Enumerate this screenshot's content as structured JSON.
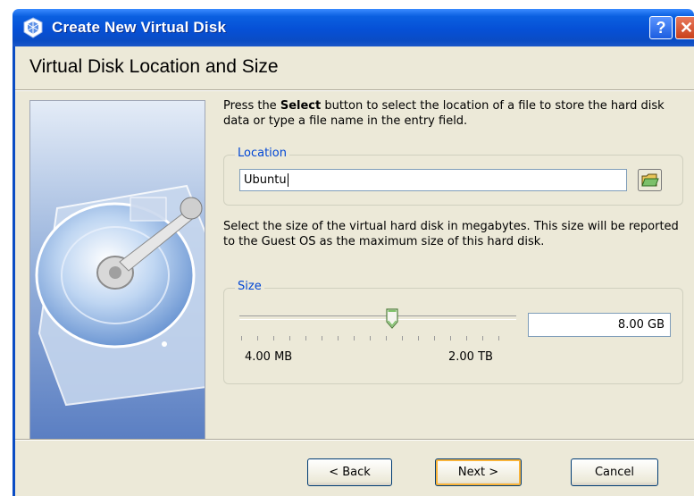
{
  "window": {
    "title": "Create New Virtual Disk",
    "help_label": "?",
    "close_label": "✕"
  },
  "page": {
    "title": "Virtual Disk Location and Size"
  },
  "intro": {
    "text_before": "Press the ",
    "bold_word": "Select",
    "text_after": " button to select the location of a file to store the hard disk data or type a file name in the entry field."
  },
  "location": {
    "legend": "Location",
    "value": "Ubuntu",
    "select_icon": "folder-open-icon"
  },
  "size": {
    "description": "Select the size of the virtual hard disk in megabytes. This size will be reported to the Guest OS as the maximum size of this hard disk.",
    "legend": "Size",
    "value": "8.00 GB",
    "min_label": "4.00 MB",
    "max_label": "2.00 TB",
    "slider_position": 0.55
  },
  "buttons": {
    "back": "< Back",
    "next": "Next >",
    "cancel": "Cancel"
  },
  "colors": {
    "titlebar": "#0a4cc4",
    "dialog_bg": "#ece9d8",
    "legend_text": "#0046d5",
    "default_button_glow": "#f8b33a"
  }
}
